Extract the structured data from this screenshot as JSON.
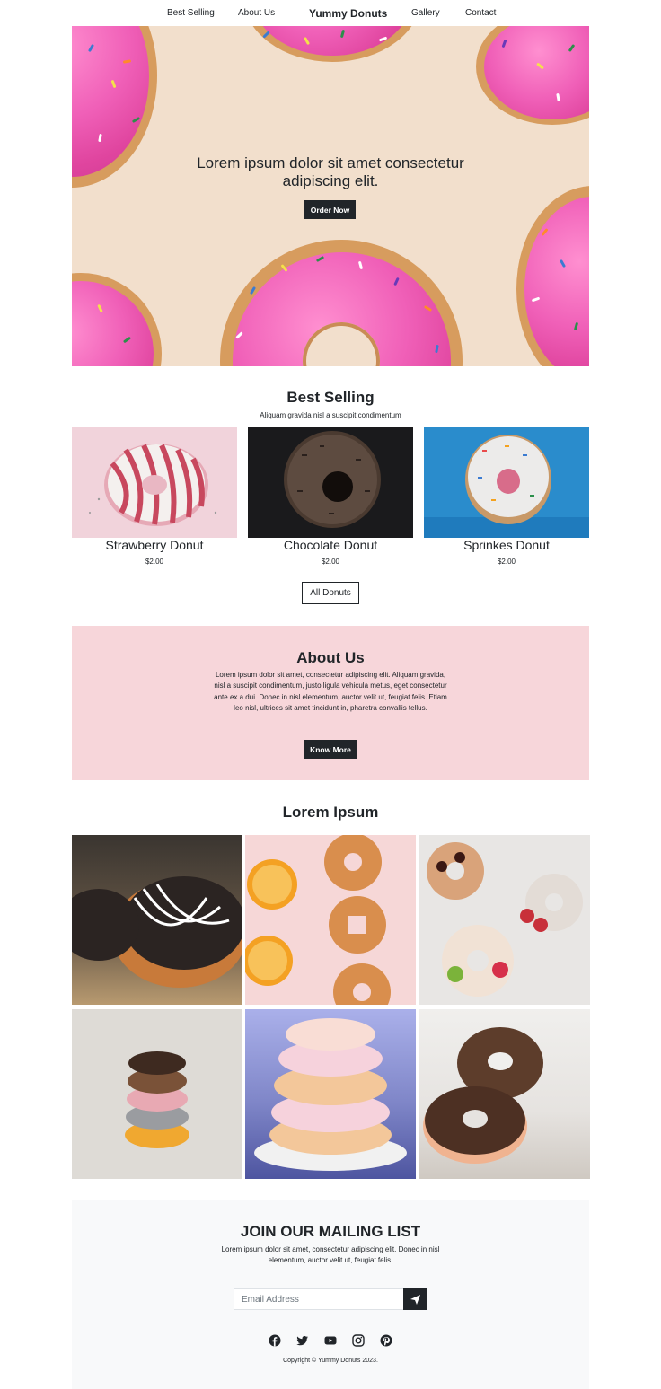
{
  "nav": {
    "best_selling": "Best Selling",
    "about_us": "About Us",
    "brand": "Yummy Donuts",
    "gallery": "Gallery",
    "contact": "Contact"
  },
  "hero": {
    "headline_line1": "Lorem ipsum dolor sit amet consectetur",
    "headline_line2": "adipiscing elit.",
    "cta_label": "Order Now"
  },
  "best_selling": {
    "title": "Best Selling",
    "subtitle": "Aliquam gravida nisl a suscipit condimentum",
    "products": [
      {
        "name": "Strawberry Donut",
        "price": "$2.00"
      },
      {
        "name": "Chocolate Donut",
        "price": "$2.00"
      },
      {
        "name": "Sprinkes Donut",
        "price": "$2.00"
      }
    ],
    "all_button": "All Donuts"
  },
  "about": {
    "title": "About Us",
    "body": "Lorem ipsum dolor sit amet, consectetur adipiscing elit. Aliquam gravida, nisl a suscipit condimentum, justo ligula vehicula metus, eget consectetur ante ex a dui. Donec in nisl elementum, auctor velit ut, feugiat felis. Etiam leo nisl, ultrices sit amet tincidunt in, pharetra convallis tellus.",
    "button": "Know More"
  },
  "gallery": {
    "title": "Lorem Ipsum"
  },
  "mailing": {
    "title": "JOIN OUR MAILING LIST",
    "body": "Lorem ipsum dolor sit amet, consectetur adipiscing elit. Donec in nisl elementum, auctor velit ut, feugiat felis.",
    "email_placeholder": "Email Address",
    "send_icon": "send-icon"
  },
  "social_icons": [
    "facebook-icon",
    "twitter-icon",
    "youtube-icon",
    "instagram-icon",
    "pinterest-icon"
  ],
  "footer": {
    "copyright": "Copyright © Yummy Donuts 2023."
  },
  "colors": {
    "dark": "#212529",
    "hero_bg": "#f2dfcc",
    "about_bg": "#f7d6da",
    "mailing_bg": "#f8f9fa",
    "icing_pink": "#f060b8"
  }
}
